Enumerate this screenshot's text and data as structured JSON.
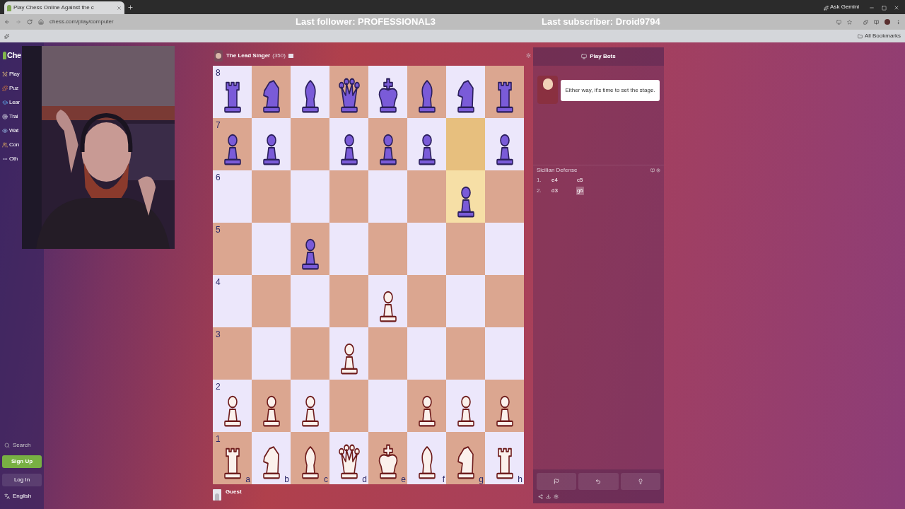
{
  "browser": {
    "tab_title": "Play Chess Online Against the c",
    "url": "chess.com/play/computer",
    "gemini": "Ask Gemini",
    "bookmarks": "All Bookmarks"
  },
  "stream_overlay": {
    "follower": "Last follower: PROFESSIONAL3",
    "subscriber": "Last subscriber: Droid9794"
  },
  "sidebar": {
    "logo": "Che",
    "items": [
      {
        "label": "Play"
      },
      {
        "label": "Puz"
      },
      {
        "label": "Lear"
      },
      {
        "label": "Trai"
      },
      {
        "label": "Wat"
      },
      {
        "label": "Con"
      },
      {
        "label": "Oth"
      }
    ],
    "search": "Search",
    "sign_up": "Sign Up",
    "log_in": "Log In",
    "language": "English"
  },
  "opponent": {
    "name": "The Lead Singer",
    "rating": "(350)"
  },
  "board": {
    "files": [
      "a",
      "b",
      "c",
      "d",
      "e",
      "f",
      "g",
      "h"
    ],
    "ranks": [
      {
        "label": "8",
        "squares": [
          {
            "kind": "rook",
            "color": "#7a5bd8",
            "highlight": false
          },
          {
            "kind": "knight",
            "color": "#7a5bd8",
            "highlight": false
          },
          {
            "kind": "bishop",
            "color": "#7a5bd8",
            "highlight": false
          },
          {
            "kind": "queen",
            "color": "#7a5bd8",
            "highlight": false
          },
          {
            "kind": "king",
            "color": "#7a5bd8",
            "highlight": false
          },
          {
            "kind": "bishop",
            "color": "#7a5bd8",
            "highlight": false
          },
          {
            "kind": "knight",
            "color": "#7a5bd8",
            "highlight": false
          },
          {
            "kind": "rook",
            "color": "#7a5bd8",
            "highlight": false
          }
        ]
      },
      {
        "label": "7",
        "squares": [
          {
            "kind": "pawn",
            "color": "#7a5bd8",
            "highlight": false
          },
          {
            "kind": "pawn",
            "color": "#7a5bd8",
            "highlight": false
          },
          {
            "highlight": false
          },
          {
            "kind": "pawn",
            "color": "#7a5bd8",
            "highlight": false
          },
          {
            "kind": "pawn",
            "color": "#7a5bd8",
            "highlight": false
          },
          {
            "kind": "pawn",
            "color": "#7a5bd8",
            "highlight": false
          },
          {
            "highlight": true
          },
          {
            "kind": "pawn",
            "color": "#7a5bd8",
            "highlight": false
          }
        ]
      },
      {
        "label": "6",
        "squares": [
          {
            "highlight": false
          },
          {
            "highlight": false
          },
          {
            "highlight": false
          },
          {
            "highlight": false
          },
          {
            "highlight": false
          },
          {
            "highlight": false
          },
          {
            "kind": "pawn",
            "color": "#7a5bd8",
            "highlight": true
          },
          {
            "highlight": false
          }
        ]
      },
      {
        "label": "5",
        "squares": [
          {
            "highlight": false
          },
          {
            "highlight": false
          },
          {
            "kind": "pawn",
            "color": "#7a5bd8",
            "highlight": false
          },
          {
            "highlight": false
          },
          {
            "highlight": false
          },
          {
            "highlight": false
          },
          {
            "highlight": false
          },
          {
            "highlight": false
          }
        ]
      },
      {
        "label": "4",
        "squares": [
          {
            "highlight": false
          },
          {
            "highlight": false
          },
          {
            "highlight": false
          },
          {
            "highlight": false
          },
          {
            "kind": "pawn",
            "color": "#fbf1ec",
            "highlight": false
          },
          {
            "highlight": false
          },
          {
            "highlight": false
          },
          {
            "highlight": false
          }
        ]
      },
      {
        "label": "3",
        "squares": [
          {
            "highlight": false
          },
          {
            "highlight": false
          },
          {
            "highlight": false
          },
          {
            "kind": "pawn",
            "color": "#fbf1ec",
            "highlight": false
          },
          {
            "highlight": false
          },
          {
            "highlight": false
          },
          {
            "highlight": false
          },
          {
            "highlight": false
          }
        ]
      },
      {
        "label": "2",
        "squares": [
          {
            "kind": "pawn",
            "color": "#fbf1ec",
            "highlight": false
          },
          {
            "kind": "pawn",
            "color": "#fbf1ec",
            "highlight": false
          },
          {
            "kind": "pawn",
            "color": "#fbf1ec",
            "highlight": false
          },
          {
            "highlight": false
          },
          {
            "highlight": false
          },
          {
            "kind": "pawn",
            "color": "#fbf1ec",
            "highlight": false
          },
          {
            "kind": "pawn",
            "color": "#fbf1ec",
            "highlight": false
          },
          {
            "kind": "pawn",
            "color": "#fbf1ec",
            "highlight": false
          }
        ]
      },
      {
        "label": "1",
        "squares": [
          {
            "kind": "rook",
            "color": "#fbf1ec",
            "highlight": false
          },
          {
            "kind": "knight",
            "color": "#fbf1ec",
            "highlight": false
          },
          {
            "kind": "bishop",
            "color": "#fbf1ec",
            "highlight": false
          },
          {
            "kind": "queen",
            "color": "#fbf1ec",
            "highlight": false
          },
          {
            "kind": "king",
            "color": "#fbf1ec",
            "highlight": false
          },
          {
            "kind": "bishop",
            "color": "#fbf1ec",
            "highlight": false
          },
          {
            "kind": "knight",
            "color": "#fbf1ec",
            "highlight": false
          },
          {
            "kind": "rook",
            "color": "#fbf1ec",
            "highlight": false
          }
        ]
      }
    ]
  },
  "player": {
    "name": "Guest"
  },
  "panel": {
    "title": "Play Bots",
    "message": "Either way, it's time to set the stage.",
    "opening": "Sicilian Defense",
    "moves": [
      {
        "number": "1.",
        "plies": [
          {
            "san": "e4",
            "selected": false
          },
          {
            "san": "c5",
            "selected": false
          }
        ]
      },
      {
        "number": "2.",
        "plies": [
          {
            "san": "d3",
            "selected": false
          },
          {
            "san": "g6",
            "selected": true
          }
        ]
      }
    ]
  }
}
